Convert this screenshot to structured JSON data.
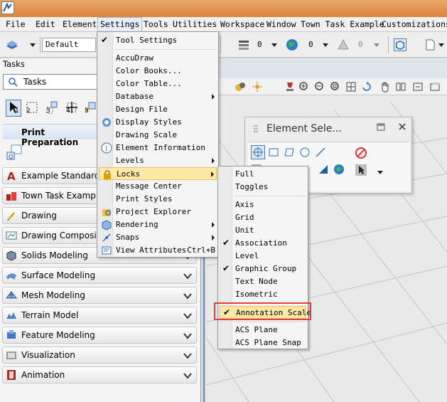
{
  "menubar": {
    "items": [
      "File",
      "Edit",
      "Element",
      "Settings",
      "Tools",
      "Utilities",
      "Workspace",
      "Window",
      "Town Task Example",
      "Customizations"
    ]
  },
  "toolbar": {
    "level_value": "Default",
    "weight_value_1": "0",
    "weight_value_2": "0",
    "weight_value_3": "0"
  },
  "tasks": {
    "panel_title": "Tasks",
    "dropdown_value": "Tasks",
    "tool_numbers": [
      "1",
      "2",
      "3",
      "4",
      "5"
    ],
    "section_header": "Print Preparation",
    "groups": [
      "Example Standards",
      "Town Task Example",
      "Drawing",
      "Drawing Composition",
      "Solids Modeling",
      "Surface Modeling",
      "Mesh Modeling",
      "Terrain Model",
      "Feature Modeling",
      "Visualization",
      "Animation"
    ]
  },
  "element_selection": {
    "title": "Element Sele..."
  },
  "settings_menu": {
    "items": [
      {
        "label": "Tool Settings",
        "checked": true
      },
      {
        "label": "AccuDraw"
      },
      {
        "label": "Color Books..."
      },
      {
        "label": "Color Table..."
      },
      {
        "label": "Database",
        "submenu": true
      },
      {
        "label": "Design File"
      },
      {
        "label": "Display Styles"
      },
      {
        "label": "Drawing Scale"
      },
      {
        "label": "Element Information"
      },
      {
        "label": "Levels",
        "submenu": true
      },
      {
        "label": "Locks",
        "submenu": true,
        "highlighted": true
      },
      {
        "label": "Message Center"
      },
      {
        "label": "Print Styles"
      },
      {
        "label": "Project Explorer"
      },
      {
        "label": "Rendering",
        "submenu": true
      },
      {
        "label": "Snaps",
        "submenu": true
      },
      {
        "label": "View Attributes",
        "shortcut": "Ctrl+B"
      }
    ]
  },
  "locks_menu": {
    "items": [
      {
        "label": "Full"
      },
      {
        "label": "Toggles"
      },
      {
        "label": "Axis"
      },
      {
        "label": "Grid"
      },
      {
        "label": "Unit"
      },
      {
        "label": "Association",
        "checked": true
      },
      {
        "label": "Level"
      },
      {
        "label": "Graphic Group",
        "checked": true
      },
      {
        "label": "Text Node"
      },
      {
        "label": "Isometric"
      },
      {
        "label": "Annotation Scale",
        "checked": true,
        "highlighted": true
      },
      {
        "label": "ACS Plane"
      },
      {
        "label": "ACS Plane Snap"
      }
    ]
  },
  "colors": {
    "accent": "#6e87b6",
    "menu_highlight": "#fde9a6",
    "callout": "#e0403c",
    "titlebar": "#d9853f"
  }
}
